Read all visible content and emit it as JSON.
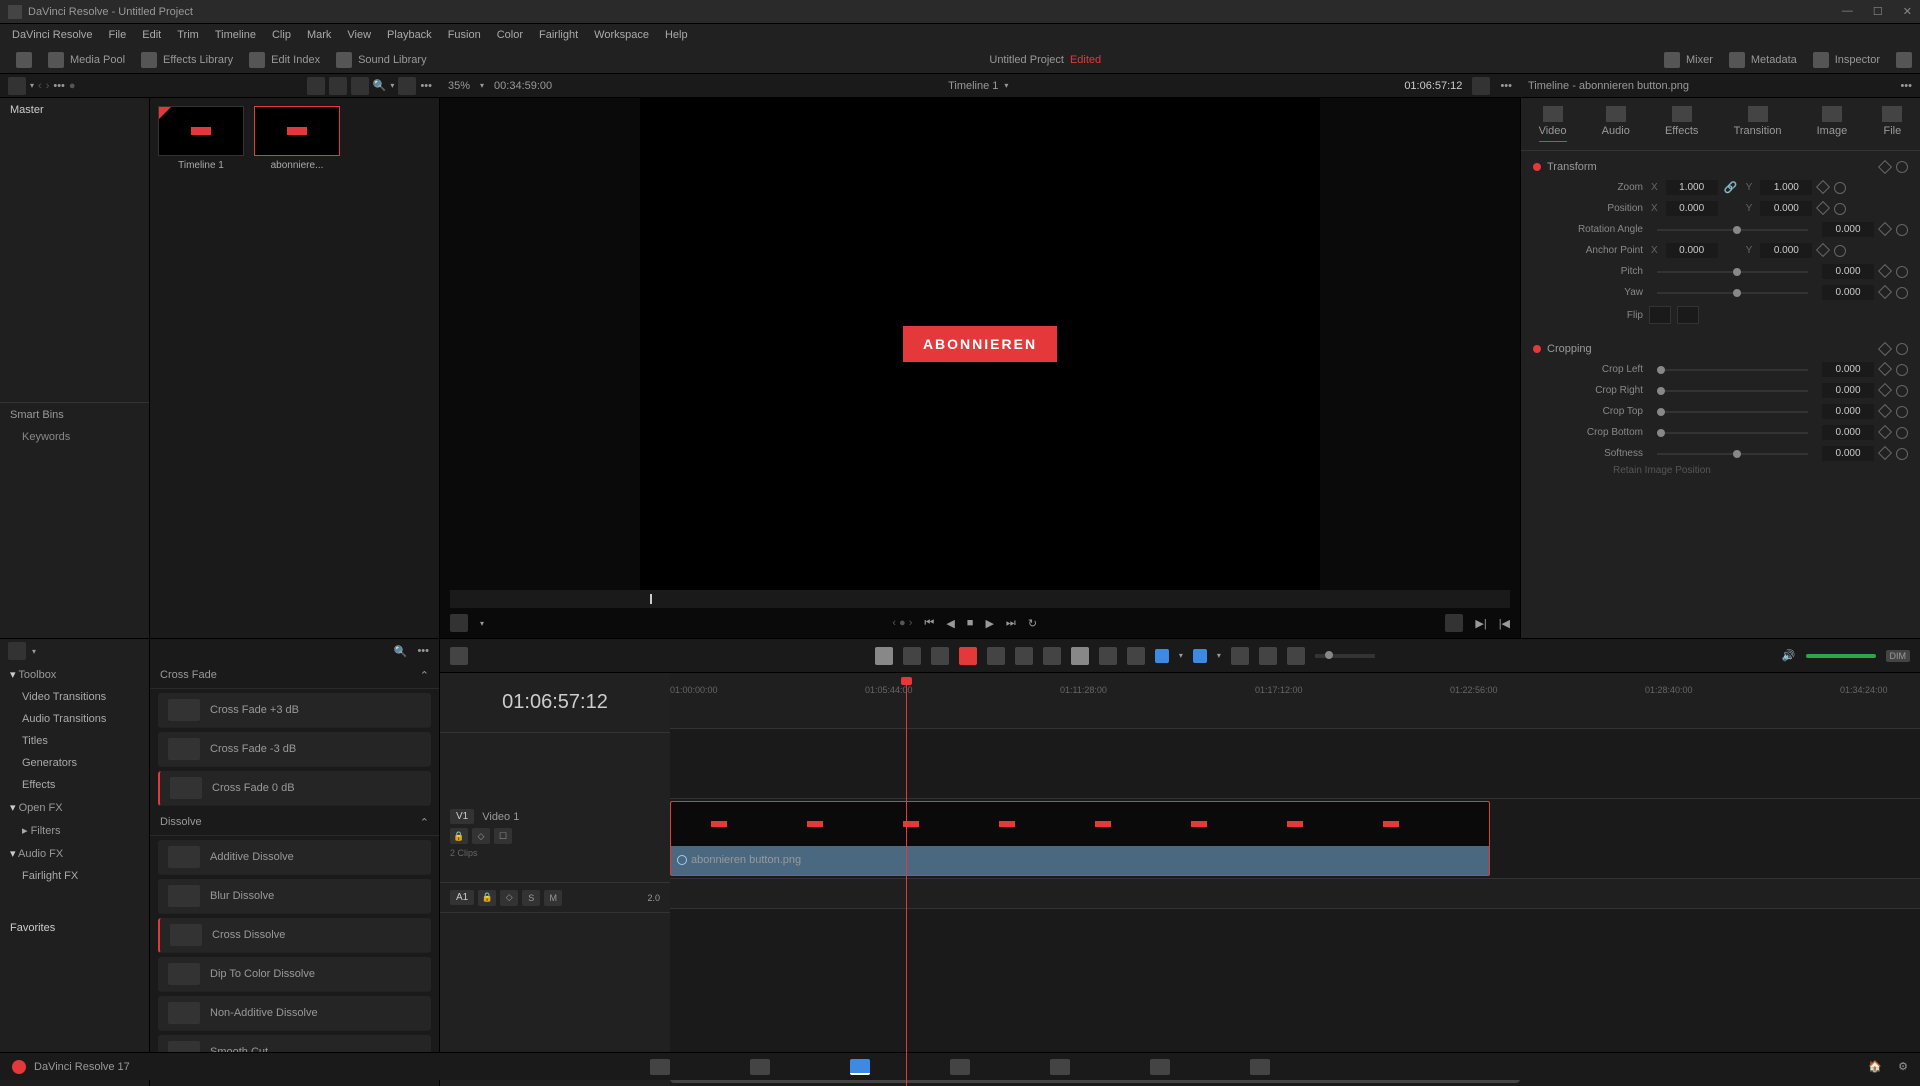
{
  "titlebar": {
    "app": "DaVinci Resolve",
    "project": "Untitled Project"
  },
  "menubar": [
    "DaVinci Resolve",
    "File",
    "Edit",
    "Trim",
    "Timeline",
    "Clip",
    "Mark",
    "View",
    "Playback",
    "Fusion",
    "Color",
    "Fairlight",
    "Workspace",
    "Help"
  ],
  "toolbar": {
    "left": [
      {
        "name": "media-pool-btn",
        "label": "Media Pool"
      },
      {
        "name": "effects-library-btn",
        "label": "Effects Library"
      },
      {
        "name": "edit-index-btn",
        "label": "Edit Index"
      },
      {
        "name": "sound-library-btn",
        "label": "Sound Library"
      }
    ],
    "project_title": "Untitled Project",
    "edited_label": "Edited",
    "right": [
      {
        "name": "mixer-btn",
        "label": "Mixer"
      },
      {
        "name": "metadata-btn",
        "label": "Metadata"
      },
      {
        "name": "inspector-btn",
        "label": "Inspector"
      }
    ]
  },
  "subbar": {
    "zoom_percent": "35%",
    "duration": "00:34:59:00",
    "timeline_name": "Timeline 1",
    "timecode": "01:06:57:12",
    "inspector_title": "Timeline - abonnieren button.png"
  },
  "media_pool": {
    "master": "Master",
    "smart_bins": "Smart Bins",
    "keywords": "Keywords",
    "thumbs": [
      {
        "label": "Timeline 1"
      },
      {
        "label": "abonniere..."
      }
    ]
  },
  "viewer": {
    "button_text": "ABONNIEREN"
  },
  "inspector": {
    "tabs": [
      "Video",
      "Audio",
      "Effects",
      "Transition",
      "Image",
      "File"
    ],
    "transform": {
      "header": "Transform",
      "zoom_label": "Zoom",
      "zoom_x": "1.000",
      "zoom_y": "1.000",
      "position_label": "Position",
      "pos_x": "0.000",
      "pos_y": "0.000",
      "rotation_label": "Rotation Angle",
      "rotation": "0.000",
      "anchor_label": "Anchor Point",
      "anchor_x": "0.000",
      "anchor_y": "0.000",
      "pitch_label": "Pitch",
      "pitch": "0.000",
      "yaw_label": "Yaw",
      "yaw": "0.000",
      "flip_label": "Flip"
    },
    "cropping": {
      "header": "Cropping",
      "left_label": "Crop Left",
      "left": "0.000",
      "right_label": "Crop Right",
      "right": "0.000",
      "top_label": "Crop Top",
      "top": "0.000",
      "bottom_label": "Crop Bottom",
      "bottom": "0.000",
      "softness_label": "Softness",
      "softness": "0.000",
      "retain_label": "Retain Image Position"
    }
  },
  "fx": {
    "categories": [
      {
        "label": "Toolbox",
        "header": true
      },
      {
        "label": "Video Transitions"
      },
      {
        "label": "Audio Transitions"
      },
      {
        "label": "Titles"
      },
      {
        "label": "Generators"
      },
      {
        "label": "Effects"
      },
      {
        "label": "Open FX",
        "header": true,
        "expand": true
      },
      {
        "label": "Filters",
        "expand": true
      },
      {
        "label": "Audio FX",
        "header": true,
        "expand": true
      },
      {
        "label": "Fairlight FX"
      },
      {
        "label": "Favorites",
        "header": true
      }
    ],
    "group1": {
      "title": "Cross Fade",
      "items": [
        "Cross Fade +3 dB",
        "Cross Fade -3 dB",
        "Cross Fade 0 dB"
      ]
    },
    "group2": {
      "title": "Dissolve",
      "items": [
        "Additive Dissolve",
        "Blur Dissolve",
        "Cross Dissolve",
        "Dip To Color Dissolve",
        "Non-Additive Dissolve",
        "Smooth Cut"
      ]
    }
  },
  "timeline": {
    "timecode": "01:06:57:12",
    "ticks": [
      "01:00:00:00",
      "01:05:44:00",
      "01:11:28:00",
      "01:17:12:00",
      "01:22:56:00",
      "01:28:40:00",
      "01:34:24:00"
    ],
    "video_track": {
      "badge": "V1",
      "label": "Video 1",
      "clips_info": "2 Clips"
    },
    "audio_track": {
      "badge": "A1",
      "value": "2.0",
      "buttons": [
        "S",
        "M"
      ]
    },
    "clip_name": "abonnieren button.png",
    "dim_label": "DIM"
  },
  "bottom": {
    "version": "DaVinci Resolve 17"
  }
}
